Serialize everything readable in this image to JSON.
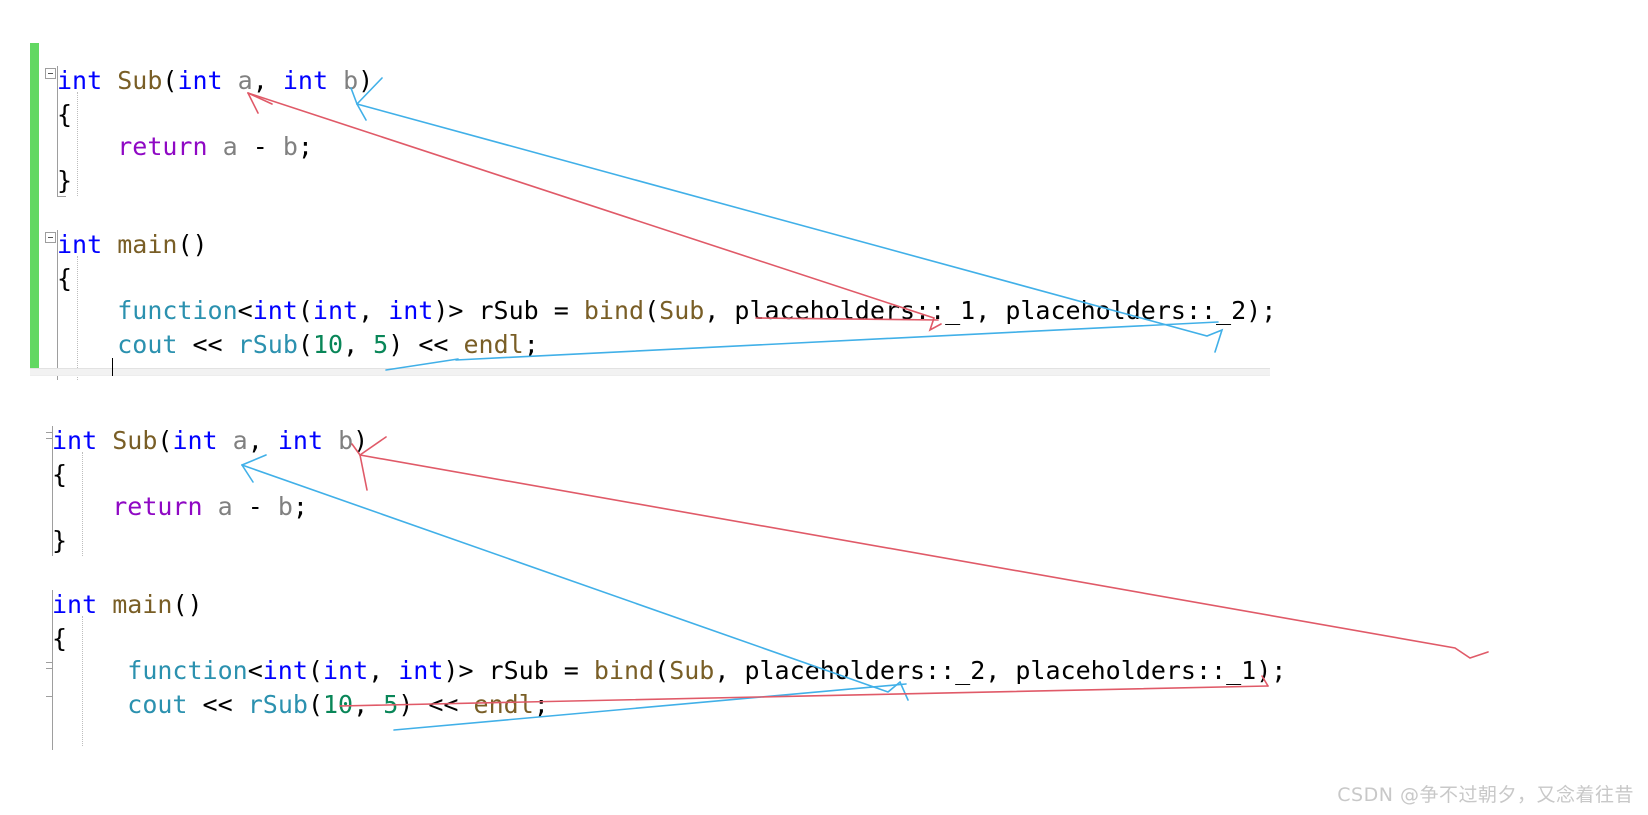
{
  "editor": {
    "language": "cpp",
    "colors": {
      "keyword": "#0000ff",
      "function": "#795e26",
      "type": "#2b91af",
      "identifier": "#808080",
      "number": "#098658",
      "return_keyword": "#8f08c4",
      "change_bar": "#62d862",
      "background": "#ffffff",
      "annotation_red": "#e05a68",
      "annotation_blue": "#41b0e8"
    }
  },
  "blocks": [
    {
      "id": "block-1",
      "has_change_bar": true,
      "lines": [
        {
          "id": "b1-l1",
          "text": "int Sub(int a, int b)"
        },
        {
          "id": "b1-l2",
          "text": "{"
        },
        {
          "id": "b1-l3",
          "text": "    return a - b;"
        },
        {
          "id": "b1-l4",
          "text": "}"
        },
        {
          "id": "b1-l5",
          "text": ""
        },
        {
          "id": "b1-l6",
          "text": "int main()"
        },
        {
          "id": "b1-l7",
          "text": "{"
        },
        {
          "id": "b1-l8",
          "text": "    function<int(int, int)> rSub = bind(Sub, placeholders::_1, placeholders::_2);"
        },
        {
          "id": "b1-l9",
          "text": "    cout << rSub(10, 5) << endl;"
        }
      ]
    },
    {
      "id": "block-2",
      "has_change_bar": false,
      "lines": [
        {
          "id": "b2-l1",
          "text": "int Sub(int a, int b)"
        },
        {
          "id": "b2-l2",
          "text": "{"
        },
        {
          "id": "b2-l3",
          "text": "    return a - b;"
        },
        {
          "id": "b2-l4",
          "text": "}"
        },
        {
          "id": "b2-l5",
          "text": ""
        },
        {
          "id": "b2-l6",
          "text": "int main()"
        },
        {
          "id": "b2-l7",
          "text": "{"
        },
        {
          "id": "b2-l8",
          "text": "     function<int(int, int)> rSub = bind(Sub, placeholders::_2, placeholders::_1);"
        },
        {
          "id": "b2-l9",
          "text": "     cout << rSub(10, 5) << endl;"
        }
      ]
    }
  ],
  "annotations": [
    {
      "id": "b1-red",
      "color": "#e05a68",
      "from": "placeholders::_1",
      "to": "parameter a"
    },
    {
      "id": "b1-blue",
      "color": "#41b0e8",
      "from": "placeholders::_2",
      "to": "parameter b"
    },
    {
      "id": "b2-blue",
      "color": "#41b0e8",
      "from": "placeholders::_2",
      "to": "parameter a"
    },
    {
      "id": "b2-red",
      "color": "#e05a68",
      "from": "placeholders::_1",
      "to": "parameter b"
    }
  ],
  "watermark": {
    "text": "CSDN @争不过朝夕，又念着往昔"
  }
}
